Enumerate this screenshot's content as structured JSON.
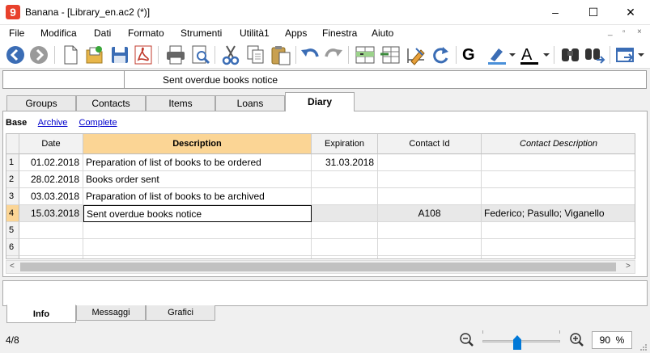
{
  "window": {
    "app_icon": "9",
    "title": "Banana - [Library_en.ac2 (*)]",
    "minimize_icon": "–",
    "maximize_icon": "☐",
    "close_icon": "✕"
  },
  "menu": {
    "items": [
      "File",
      "Modifica",
      "Dati",
      "Formato",
      "Strumenti",
      "Utilità1",
      "Apps",
      "Finestra",
      "Aiuto"
    ],
    "mdi_minimize": "_",
    "mdi_restore": "▫",
    "mdi_close": "×"
  },
  "toolbar": {
    "icons": [
      "back-icon",
      "forward-icon",
      "new-file-icon",
      "open-folder-icon",
      "save-icon",
      "pdf-icon",
      "print-icon",
      "print-preview-icon",
      "cut-icon",
      "copy-icon",
      "paste-icon",
      "undo-icon",
      "redo-icon",
      "add-row-icon",
      "delete-row-icon",
      "edit-icon",
      "refresh-icon",
      "bold-icon",
      "highlighter-icon",
      "font-color-icon",
      "find-icon",
      "find-next-icon",
      "window-icon"
    ],
    "bold_label": "G",
    "font_color_label": "A",
    "highlight_color": "#4a90d9",
    "font_color": "#000000"
  },
  "address_bar": {
    "cell_ref": "",
    "content": "Sent overdue books notice"
  },
  "tabs": [
    "Groups",
    "Contacts",
    "Items",
    "Loans",
    "Diary"
  ],
  "active_tab": "Diary",
  "views": [
    "Base",
    "Archive",
    "Complete"
  ],
  "active_view": "Base",
  "table": {
    "columns": [
      "Date",
      "Description",
      "Expiration",
      "Contact Id",
      "Contact Description"
    ],
    "rows": [
      {
        "n": "1",
        "date": "01.02.2018",
        "desc": "Preparation of list of books to be ordered",
        "exp": "31.03.2018",
        "cid": "",
        "cdesc": ""
      },
      {
        "n": "2",
        "date": "28.02.2018",
        "desc": "Books order sent",
        "exp": "",
        "cid": "",
        "cdesc": ""
      },
      {
        "n": "3",
        "date": "03.03.2018",
        "desc": "Praparation of list of books to be archived",
        "exp": "",
        "cid": "",
        "cdesc": ""
      },
      {
        "n": "4",
        "date": "15.03.2018",
        "desc": "Sent overdue books notice",
        "exp": "",
        "cid": "A108",
        "cdesc": "Federico; Pasullo; Viganello"
      },
      {
        "n": "5",
        "date": "",
        "desc": "",
        "exp": "",
        "cid": "",
        "cdesc": ""
      },
      {
        "n": "6",
        "date": "",
        "desc": "",
        "exp": "",
        "cid": "",
        "cdesc": ""
      },
      {
        "n": "",
        "date": "",
        "desc": "",
        "exp": "",
        "cid": "",
        "cdesc": ""
      }
    ],
    "selected_row": "4",
    "highlight_color": "#fbd595"
  },
  "scroll": {
    "left_arrow": "<",
    "right_arrow": ">"
  },
  "bottom_tabs": [
    "Info",
    "Messaggi",
    "Grafici"
  ],
  "active_bottom_tab": "Info",
  "status": {
    "position": "4/8",
    "zoom_value": "90",
    "zoom_unit": "%"
  }
}
